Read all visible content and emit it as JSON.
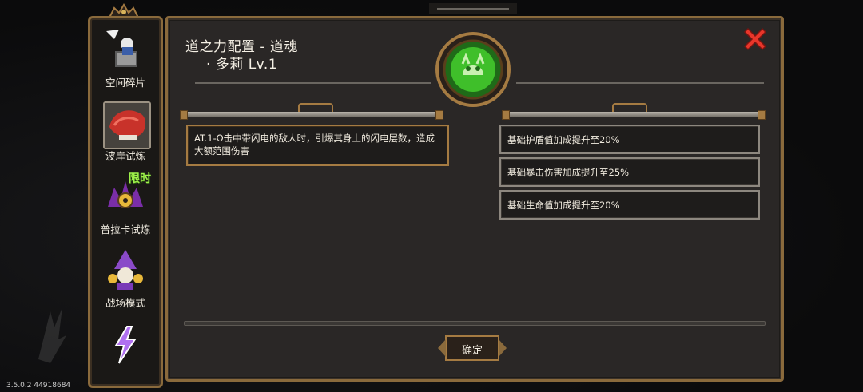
{
  "sidebar": {
    "items": [
      {
        "label": "空间碎片",
        "icon": "space-fragment-icon"
      },
      {
        "label": "波岸试炼",
        "icon": "red-dragon-icon"
      },
      {
        "label": "普拉卡试炼",
        "icon": "prakar-trial-icon",
        "badge": "限时"
      },
      {
        "label": "战场模式",
        "icon": "wizard-icon"
      },
      {
        "label": "",
        "icon": "lightning-icon"
      }
    ]
  },
  "panel": {
    "title_line1": "道之力配置 - 道魂",
    "title_line2": "· 多莉 Lv.1",
    "skill_text": "AT.1-Ω击中带闪电的敌人时，引爆其身上的闪电层数，造成大额范围伤害",
    "bonuses": [
      "基础护盾值加成提升至20%",
      "基础暴击伤害加成提升至25%",
      "基础生命值加成提升至20%"
    ],
    "confirm_label": "确定"
  },
  "version": "3.5.0.2 44918684",
  "colors": {
    "frame_gold": "#a57b42",
    "close_red": "#e8362a",
    "badge_green": "#9ef04a",
    "emblem_green": "#3fbf2a"
  }
}
